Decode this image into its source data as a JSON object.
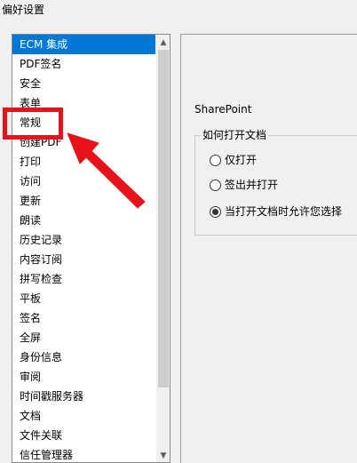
{
  "window": {
    "title": "偏好设置"
  },
  "categories": {
    "items": [
      {
        "label": "ECM 集成",
        "selected": true
      },
      {
        "label": "PDF签名"
      },
      {
        "label": "安全"
      },
      {
        "label": "表单"
      },
      {
        "label": "常规"
      },
      {
        "label": "创建PDF"
      },
      {
        "label": "打印"
      },
      {
        "label": "访问"
      },
      {
        "label": "更新"
      },
      {
        "label": "朗读"
      },
      {
        "label": "历史记录"
      },
      {
        "label": "内容订阅"
      },
      {
        "label": "拼写检查"
      },
      {
        "label": "平板"
      },
      {
        "label": "签名"
      },
      {
        "label": "全屏"
      },
      {
        "label": "身份信息"
      },
      {
        "label": "审阅"
      },
      {
        "label": "时间戳服务器"
      },
      {
        "label": "文档"
      },
      {
        "label": "文件关联"
      },
      {
        "label": "信任管理器"
      }
    ]
  },
  "settings": {
    "section_title": "SharePoint",
    "group_label": "如何打开文档",
    "options": [
      {
        "label": "仅打开",
        "checked": false
      },
      {
        "label": "签出并打开",
        "checked": false
      },
      {
        "label": "当打开文档时允许您选择",
        "checked": true
      }
    ]
  },
  "colors": {
    "selection": "#0078d7",
    "annotation_red": "#e8121b"
  },
  "icons": {
    "scroll_up": "chevron-up-icon",
    "scroll_down": "chevron-down-icon"
  }
}
